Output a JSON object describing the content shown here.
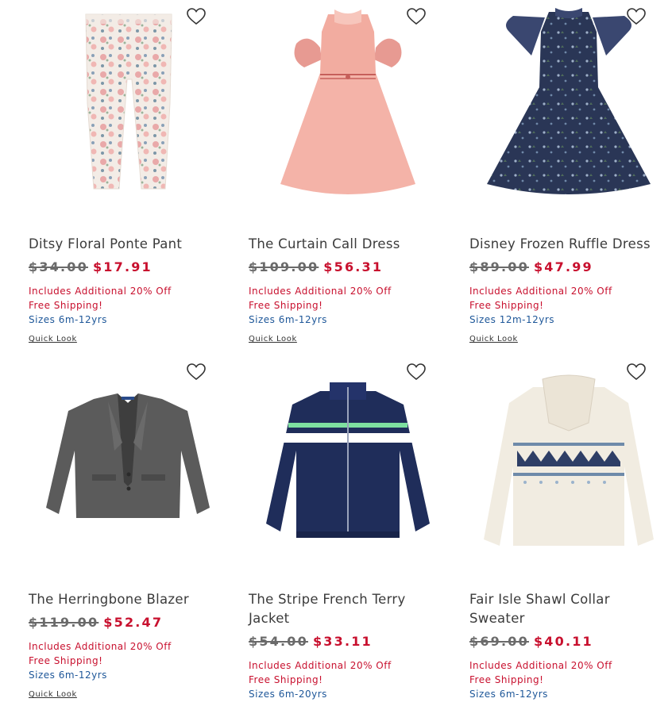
{
  "products": [
    {
      "name": "Ditsy Floral Ponte Pant",
      "original_price": "$34.00",
      "sale_price": "$17.91",
      "promo": "Includes Additional 20% Off",
      "shipping": "Free Shipping!",
      "sizes": "Sizes 6m-12yrs",
      "quick_look": "Quick Look",
      "image": "floral-pants-image"
    },
    {
      "name": "The Curtain Call Dress",
      "original_price": "$109.00",
      "sale_price": "$56.31",
      "promo": "Includes Additional 20% Off",
      "shipping": "Free Shipping!",
      "sizes": "Sizes 6m-12yrs",
      "quick_look": "Quick Look",
      "image": "pink-tulle-dress-image"
    },
    {
      "name": "Disney Frozen Ruffle Dress",
      "original_price": "$89.00",
      "sale_price": "$47.99",
      "promo": "Includes Additional 20% Off",
      "shipping": "Free Shipping!",
      "sizes": "Sizes 12m-12yrs",
      "quick_look": "Quick Look",
      "image": "navy-print-dress-image"
    },
    {
      "name": "The Herringbone Blazer",
      "original_price": "$119.00",
      "sale_price": "$52.47",
      "promo": "Includes Additional 20% Off",
      "shipping": "Free Shipping!",
      "sizes": "Sizes 6m-12yrs",
      "quick_look": "Quick Look",
      "image": "gray-blazer-image"
    },
    {
      "name": "The Stripe French Terry Jacket",
      "original_price": "$54.00",
      "sale_price": "$33.11",
      "promo": "Includes Additional 20% Off",
      "shipping": "Free Shipping!",
      "sizes": "Sizes 6m-20yrs",
      "image": "navy-stripe-jacket-image"
    },
    {
      "name": "Fair Isle Shawl Collar Sweater",
      "original_price": "$69.00",
      "sale_price": "$40.11",
      "promo": "Includes Additional 20% Off",
      "shipping": "Free Shipping!",
      "sizes": "Sizes 6m-12yrs",
      "image": "fair-isle-sweater-image"
    }
  ],
  "icons": {
    "favorite": "heart-outline-icon"
  },
  "colors": {
    "sale": "#c8102e",
    "sizes": "#1e5799",
    "text": "#3b3b3b"
  }
}
